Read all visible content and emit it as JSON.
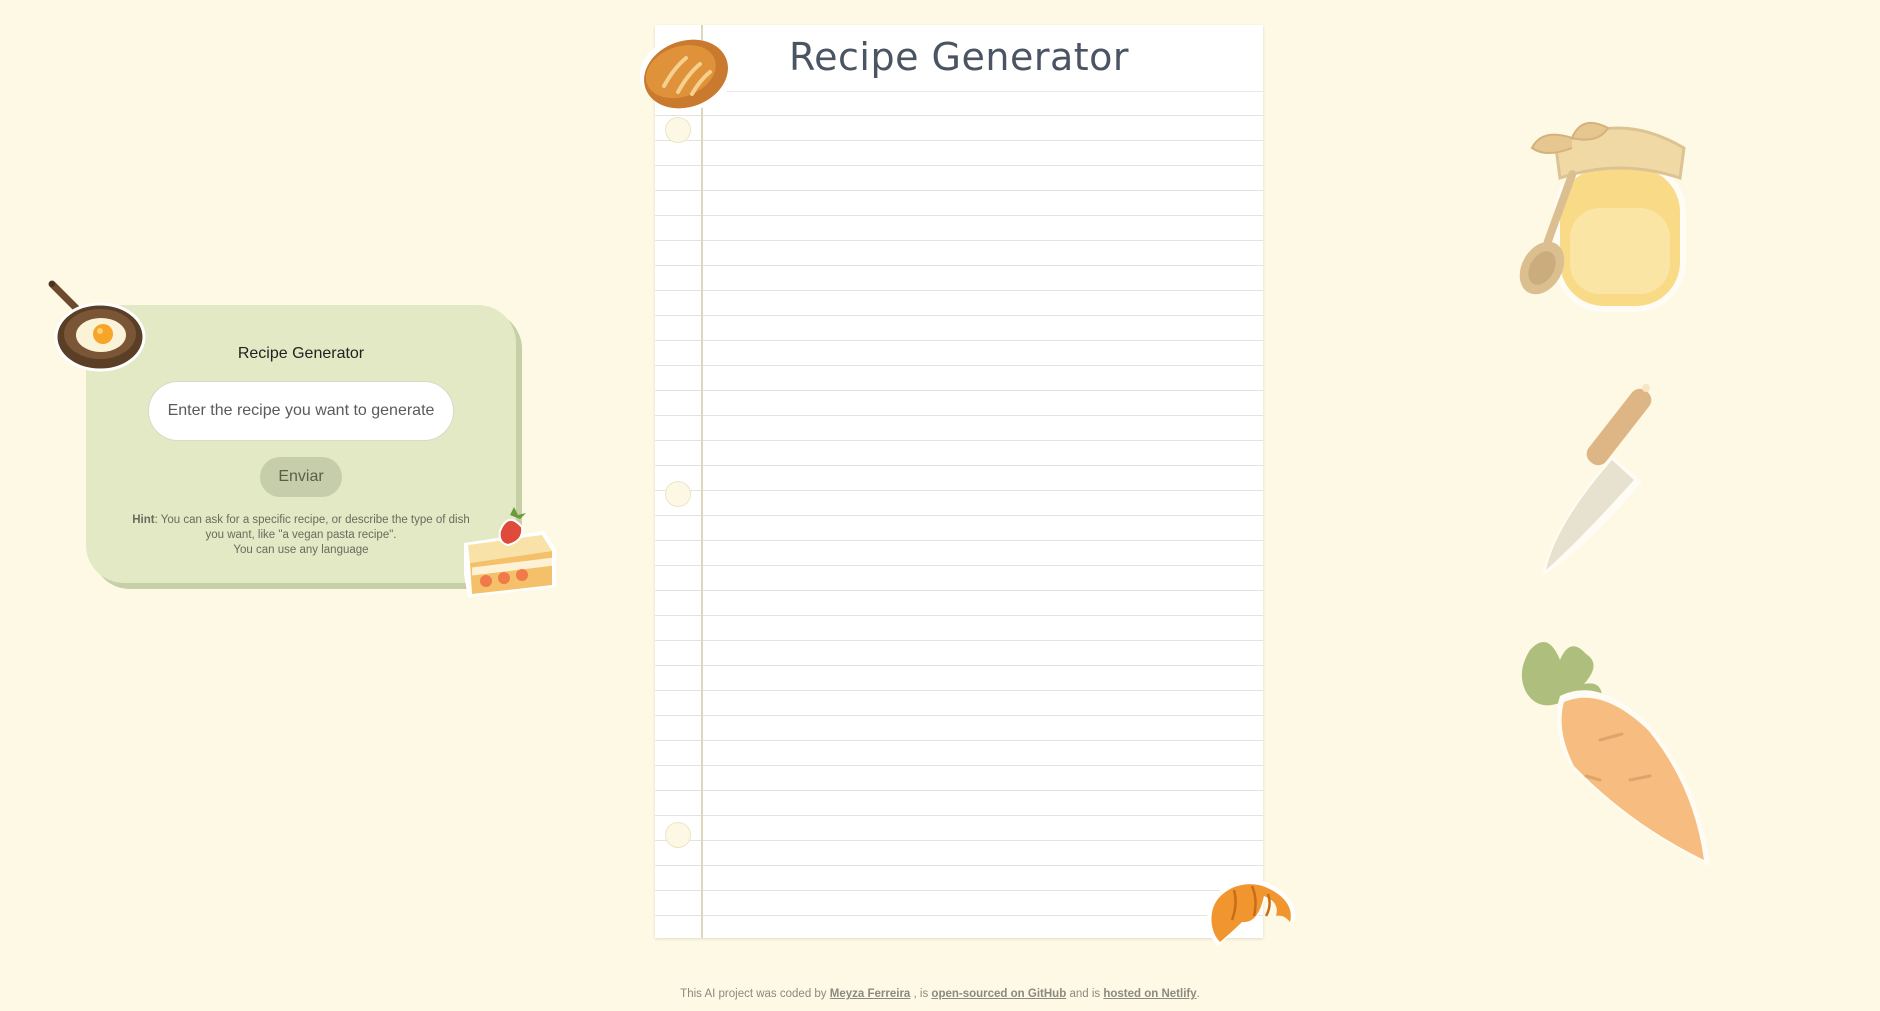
{
  "form_card": {
    "title": "Recipe Generator",
    "input_placeholder": "Enter the recipe you want to generate",
    "input_value": "",
    "submit_label": "Enviar",
    "hint_label": "Hint",
    "hint_line1": ": You can ask for a specific recipe, or describe the type of dish",
    "hint_line2": "you want, like \"a vegan pasta recipe\".",
    "hint_line3": "You can use any language"
  },
  "paper": {
    "title": "Recipe Generator"
  },
  "footer": {
    "prefix": "This AI project was coded by",
    "author_link": "Meyza Ferreira",
    "mid1": ", is",
    "github_link": "open-sourced on GitHub",
    "mid2": "and is",
    "netlify_link": "hosted on Netlify",
    "suffix": "."
  },
  "colors": {
    "page_background": "#fef9e4",
    "card_background": "#e2e9c4",
    "button_background": "#c5cdaa",
    "paper_title": "#4b5463"
  },
  "icons": [
    "frying-pan-icon",
    "cake-slice-icon",
    "bread-icon",
    "croissant-icon",
    "honey-jar-icon",
    "knife-icon",
    "carrot-icon"
  ]
}
